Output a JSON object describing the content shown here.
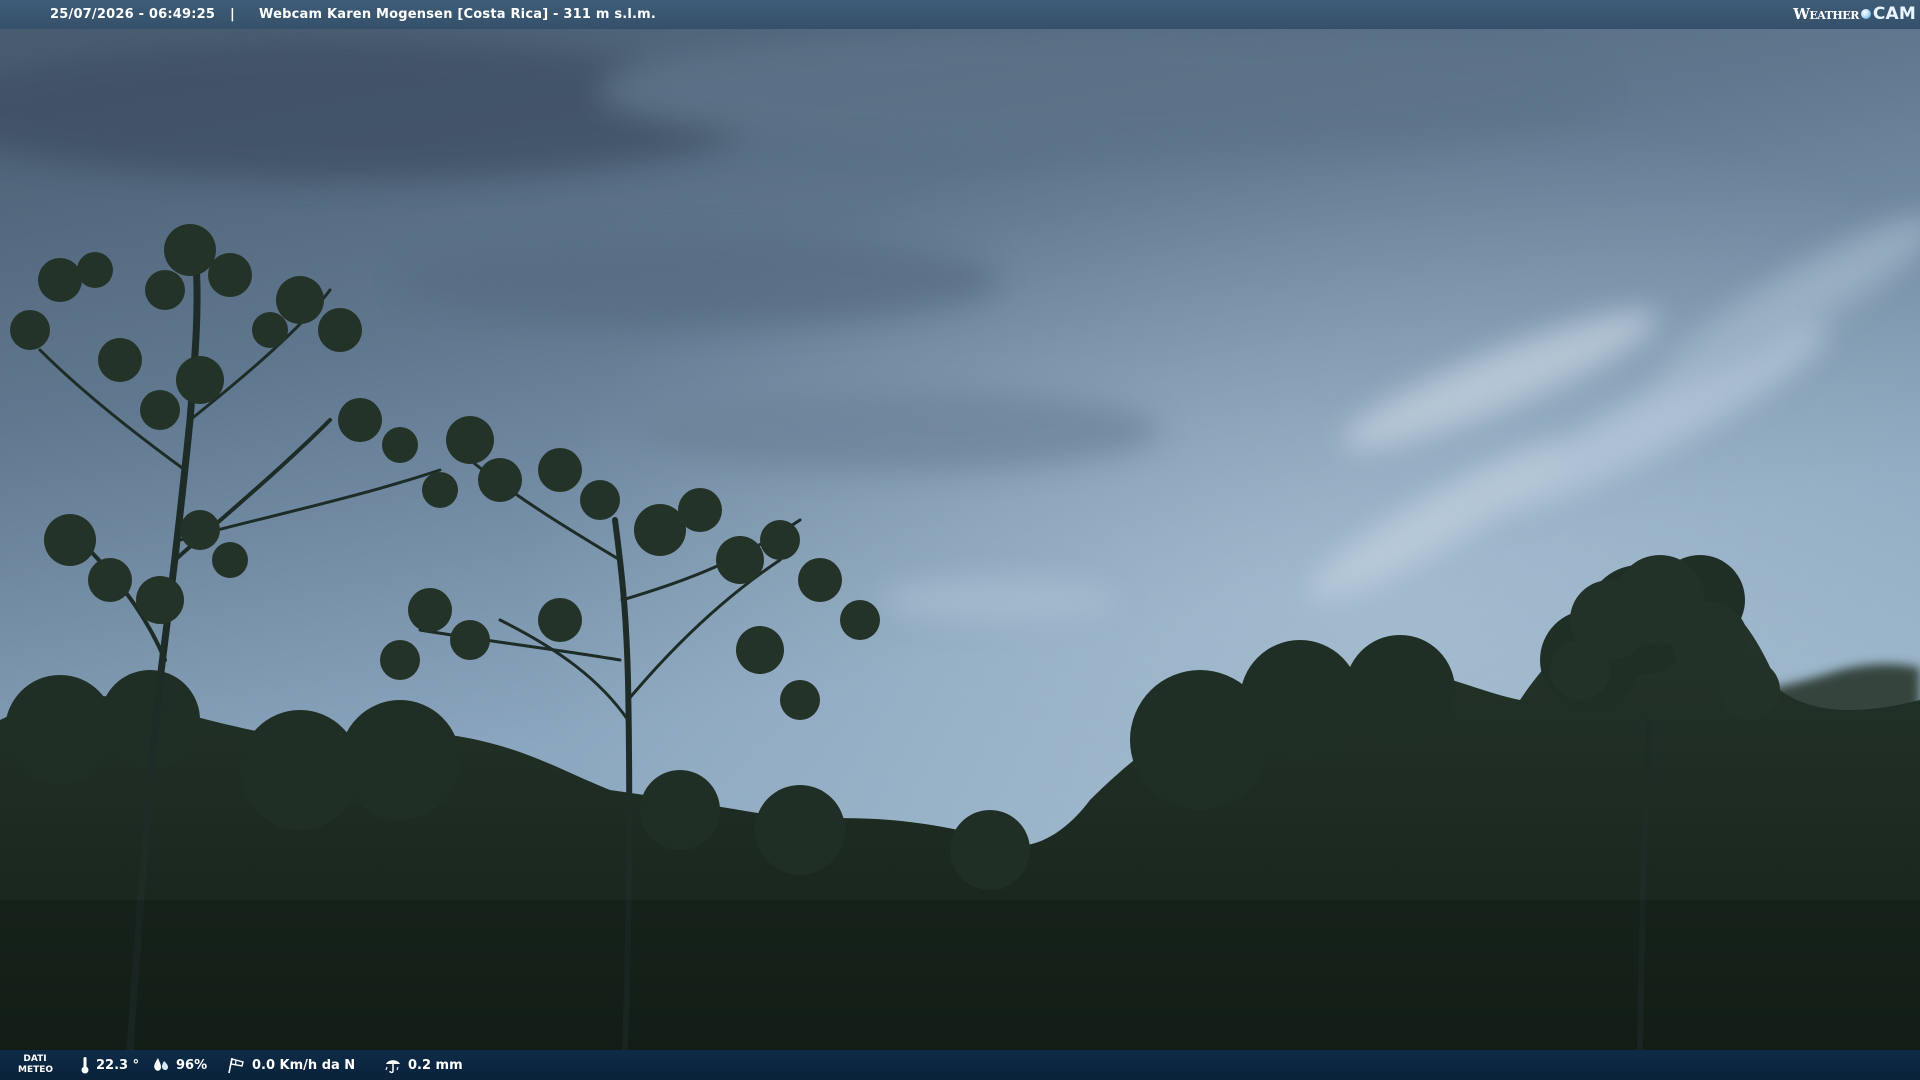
{
  "header": {
    "timestamp": "25/07/2026 - 06:49:25",
    "separator": "|",
    "title": "Webcam Karen Mogensen [Costa Rica]  - 311 m s.l.m.",
    "logo_word": "Weather",
    "logo_cam": "CAM"
  },
  "footer": {
    "label_line1": "DATI",
    "label_line2": "METEO",
    "temperature": "22.3 °",
    "humidity": "96%",
    "wind": "0.0 Km/h da N",
    "rain": "0.2 mm"
  },
  "icons": {
    "temperature": "thermometer-icon",
    "humidity": "humidity-drops-icon",
    "wind": "wind-sock-icon",
    "rain": "rain-gauge-icon",
    "logo": "weathercam-logo"
  },
  "colors": {
    "topbar": "#3f5d78",
    "bottombar": "#0e2b47",
    "sky_top": "#4a5f75",
    "sky_mid": "#8aa6bf",
    "forest": "#1d2b22"
  }
}
